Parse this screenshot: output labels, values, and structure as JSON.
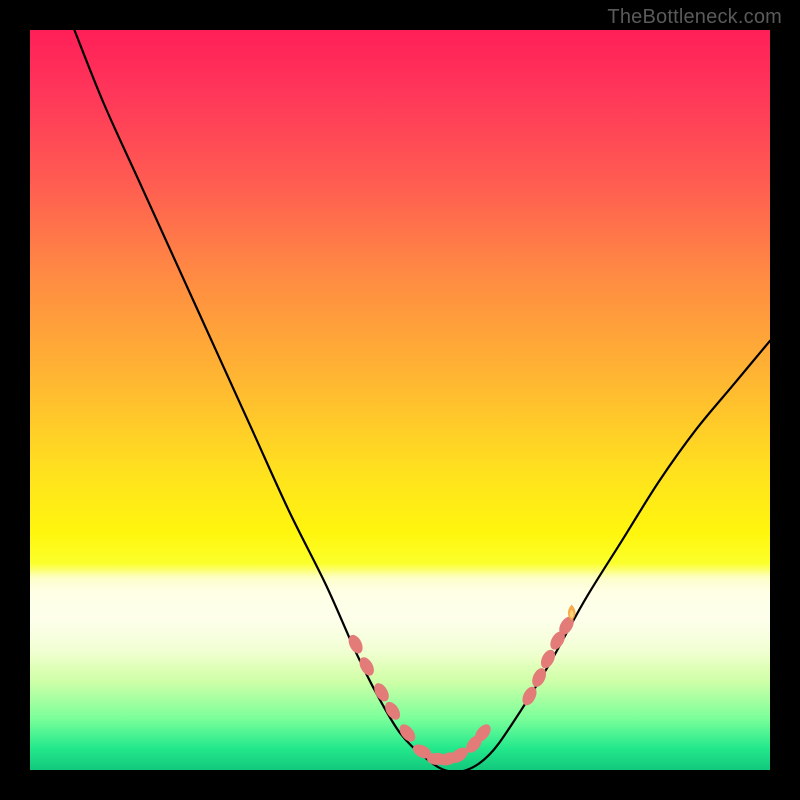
{
  "watermark": "TheBottleneck.com",
  "chart_data": {
    "type": "line",
    "title": "",
    "xlabel": "",
    "ylabel": "",
    "xlim": [
      0,
      100
    ],
    "ylim": [
      0,
      100
    ],
    "grid": false,
    "legend": false,
    "annotations": [],
    "background_gradient_stops": [
      {
        "pos": 0,
        "color": "#ff1f57"
      },
      {
        "pos": 60,
        "color": "#ffe21e"
      },
      {
        "pos": 75,
        "color": "#fdffc8"
      },
      {
        "pos": 100,
        "color": "#12c87c"
      }
    ],
    "series": [
      {
        "name": "curve",
        "color": "#000000",
        "x": [
          6,
          10,
          15,
          20,
          25,
          30,
          35,
          40,
          44,
          47,
          50,
          53,
          56,
          59,
          62,
          65,
          70,
          75,
          80,
          85,
          90,
          95,
          100
        ],
        "y": [
          100,
          90,
          79,
          68,
          57,
          46,
          35,
          25,
          16,
          10,
          5,
          2,
          0,
          0,
          2,
          6,
          14,
          23,
          31,
          39,
          46,
          52,
          58
        ]
      }
    ],
    "markers": [
      {
        "name": "left-cluster",
        "color": "#e37b79",
        "shape": "rounded",
        "x": [
          44,
          45.5,
          47.5,
          49,
          51,
          53,
          55,
          56.5,
          58,
          60,
          61.2
        ],
        "y": [
          17,
          14,
          10.5,
          8,
          5,
          2.5,
          1.5,
          1.5,
          2,
          3.5,
          5
        ]
      },
      {
        "name": "right-cluster",
        "color": "#e37b79",
        "shape": "rounded",
        "x": [
          67.5,
          68.8,
          70,
          71.3,
          72.5
        ],
        "y": [
          10,
          12.5,
          15,
          17.5,
          19.5
        ]
      },
      {
        "name": "right-flame",
        "color": "#f6a33a",
        "shape": "flame",
        "x": [
          73.2
        ],
        "y": [
          21
        ]
      }
    ]
  }
}
